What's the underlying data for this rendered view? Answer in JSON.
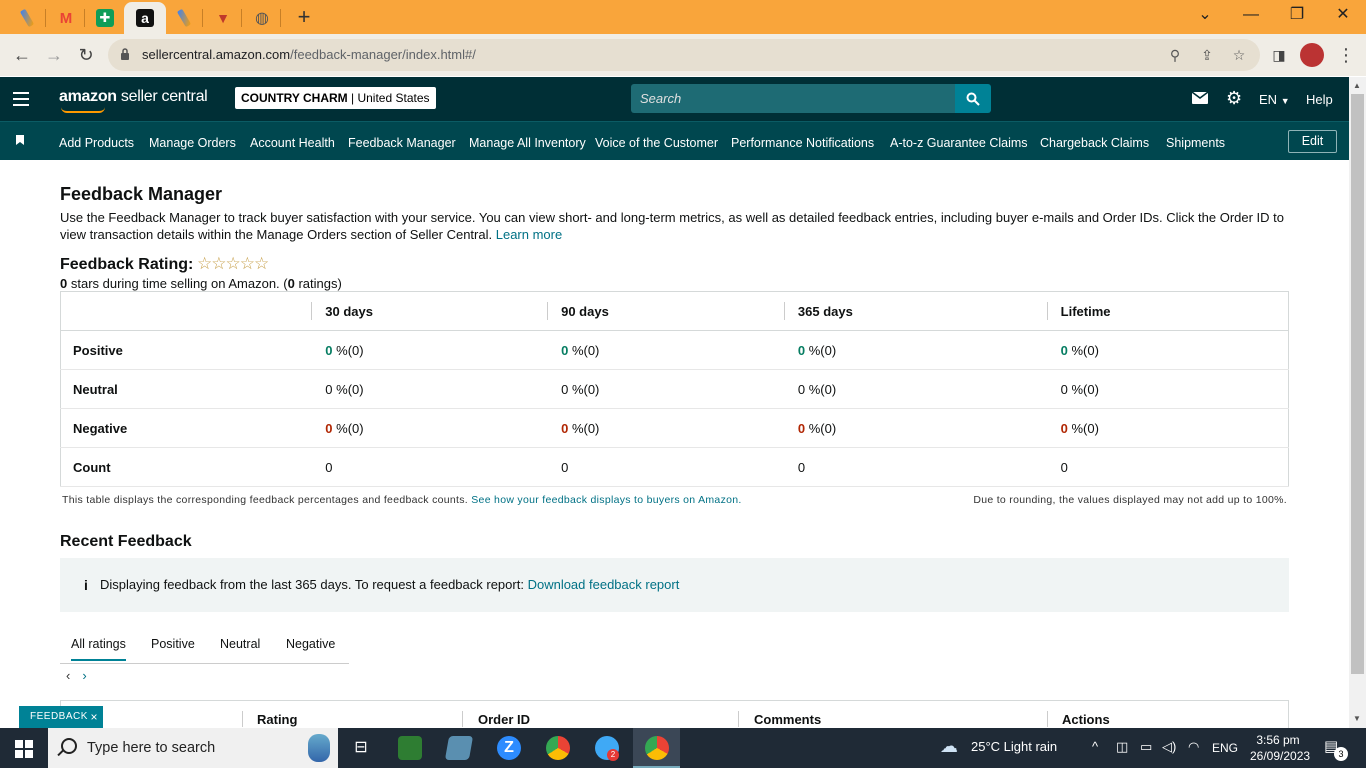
{
  "browser": {
    "url_host": "sellercentral.amazon.com",
    "url_path": "/feedback-manager/index.html#/",
    "tab_icons": [
      "tab-icon-edit",
      "gmail-icon",
      "sheets-icon",
      "amazon-icon",
      "tab-icon-edit",
      "tab-icon-red",
      "globe-icon"
    ],
    "new_tab": "+",
    "window_controls": {
      "minimize": "—",
      "restore": "❐",
      "close": "✕",
      "tabs_dropdown": "⌄"
    }
  },
  "header": {
    "logo_bold": "amazon",
    "logo_rest": " seller central",
    "store_name": "COUNTRY CHARM",
    "store_sep": " | ",
    "store_region": "United States",
    "search_placeholder": "Search",
    "lang": "EN",
    "help": "Help"
  },
  "subnav": {
    "items": [
      "Add Products",
      "Manage Orders",
      "Account Health",
      "Feedback Manager",
      "Manage All Inventory",
      "Voice of the Customer",
      "Performance Notifications",
      "A-to-z Guarantee Claims",
      "Chargeback Claims",
      "Shipments"
    ],
    "edit": "Edit"
  },
  "page": {
    "title": "Feedback Manager",
    "intro": "Use the Feedback Manager to track buyer satisfaction with your service. You can view short- and long-term metrics, as well as detailed feedback entries, including buyer e-mails and Order IDs. Click the Order ID to view transaction details within the Manage Orders section of Seller Central.",
    "learn_more": "Learn more",
    "rating_label": "Feedback Rating:",
    "stars": "☆☆☆☆☆",
    "rating_sub_value": "0",
    "rating_sub_text": " stars during time selling on Amazon. (",
    "rating_count": "0",
    "rating_sub_end": " ratings)"
  },
  "feedback_table": {
    "columns": [
      "30 days",
      "90 days",
      "365 days",
      "Lifetime"
    ],
    "rows": [
      {
        "label": "Positive",
        "cells": [
          [
            "0",
            " %(0)"
          ],
          [
            "0",
            " %(0)"
          ],
          [
            "0",
            " %(0)"
          ],
          [
            "0",
            " %(0)"
          ]
        ]
      },
      {
        "label": "Neutral",
        "cells": [
          [
            "0",
            " %(0)"
          ],
          [
            "0",
            " %(0)"
          ],
          [
            "0",
            " %(0)"
          ],
          [
            "0",
            " %(0)"
          ]
        ]
      },
      {
        "label": "Negative",
        "cells": [
          [
            "0",
            " %(0)"
          ],
          [
            "0",
            " %(0)"
          ],
          [
            "0",
            " %(0)"
          ],
          [
            "0",
            " %(0)"
          ]
        ]
      },
      {
        "label": "Count",
        "cells": [
          [
            "0",
            ""
          ],
          [
            "0",
            ""
          ],
          [
            "0",
            ""
          ],
          [
            "0",
            ""
          ]
        ]
      }
    ],
    "note_left": "This table displays the corresponding feedback percentages and feedback counts.",
    "note_link": "See how your feedback displays to buyers on Amazon.",
    "note_right": "Due to rounding, the values displayed may not add up to 100%."
  },
  "recent": {
    "title": "Recent Feedback",
    "info_icon": "i",
    "info_text": "Displaying feedback from the last 365 days. To request a feedback report:",
    "info_link": "Download feedback report",
    "tabs": [
      "All ratings",
      "Positive",
      "Neutral",
      "Negative"
    ],
    "pager_prev": "‹",
    "pager_next": "›",
    "columns": [
      "Rating",
      "Order ID",
      "Comments",
      "Actions"
    ]
  },
  "feedback_tag": {
    "label": "FEEDBACK",
    "close": "×"
  },
  "taskbar": {
    "search_placeholder": "Type here to search",
    "weather": "25°C  Light rain",
    "lang": "ENG",
    "time": "3:56 pm",
    "date": "26/09/2023",
    "notifications": "3",
    "badge": "2"
  }
}
